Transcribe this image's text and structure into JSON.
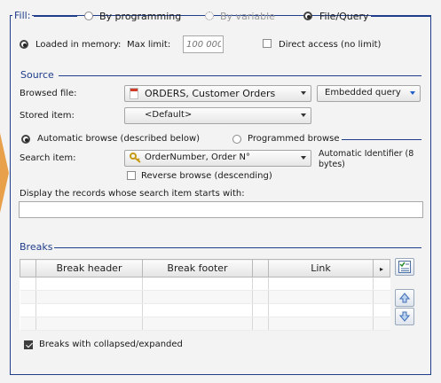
{
  "fill": {
    "legend": "Fill:",
    "by_programming": "By programming",
    "by_variable": "By variable",
    "file_query": "File/Query"
  },
  "memory": {
    "loaded_label": "Loaded in memory:",
    "max_limit_label": "Max limit:",
    "max_limit_placeholder": "100 000",
    "direct_access": "Direct access (no limit)"
  },
  "source": {
    "legend": "Source",
    "browsed_file_label": "Browsed file:",
    "browsed_file_value": "ORDERS, Customer Orders",
    "embedded_query_button": "Embedded query",
    "stored_item_label": "Stored item:",
    "stored_item_value": "<Default>",
    "automatic_browse": "Automatic browse (described below)",
    "programmed_browse": "Programmed browse",
    "search_item_label": "Search item:",
    "search_item_value": "OrderNumber, Order N°",
    "search_item_info": "Automatic Identifier (8 bytes)",
    "reverse_browse": "Reverse browse (descending)",
    "display_records_label": "Display the records whose search item starts with:",
    "display_records_value": ""
  },
  "breaks": {
    "legend": "Breaks",
    "columns": [
      "Break header",
      "Break footer",
      "Link"
    ],
    "collapsed_expanded": "Breaks with collapsed/expanded",
    "collapsed_checked": true
  },
  "colors": {
    "frame": "#1f3d8a",
    "background": "#f3f3f3",
    "accent": "#e8a04a"
  },
  "icons": {
    "file": "file-icon",
    "key": "key-icon",
    "table_scroll": "chevron-right-icon",
    "select_all": "checklist-icon",
    "move_up": "arrow-up-icon",
    "move_down": "arrow-down-icon"
  }
}
